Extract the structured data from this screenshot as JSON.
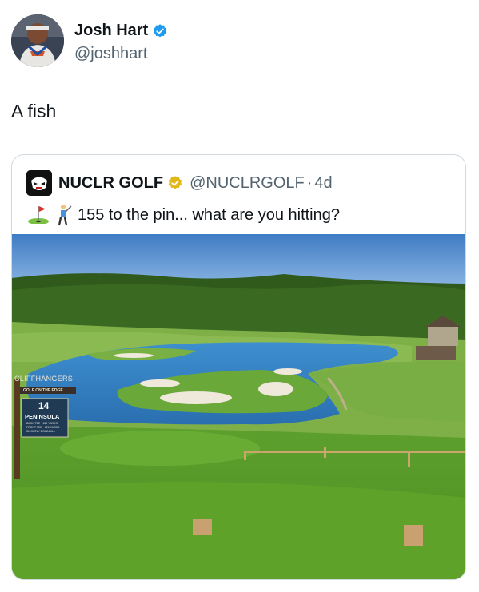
{
  "post": {
    "author": {
      "display_name": "Josh Hart",
      "handle": "@joshhart",
      "verified": true,
      "avatar_icon": "player-avatar"
    },
    "text": "A fish"
  },
  "quoted_post": {
    "author": {
      "display_name": "NUCLR GOLF",
      "handle": "@NUCLRGOLF",
      "verified": true,
      "badge_icon": "gold-verified-badge",
      "avatar_icon": "nuclr-golf-logo"
    },
    "separator": "·",
    "time": "4d",
    "emoji": [
      "golf-hole-flag-emoji",
      "golfer-emoji"
    ],
    "text": "155 to the pin... what are you hitting?",
    "image": {
      "sign_brand": "CLIFFHANGERS",
      "sign_tagline": "GOLF ON THE EDGE",
      "hole_number": "14",
      "hole_name": "PENINSULA",
      "sign_details": [
        "BACK TEE · 155 YARDS",
        "FRONT TEE · 120 YARDS",
        "SLIGHTLY DOWNHILL"
      ]
    }
  },
  "colors": {
    "verified_blue": "#1d9bf0",
    "verified_gold": "#e2b719",
    "secondary_text": "#536471"
  }
}
